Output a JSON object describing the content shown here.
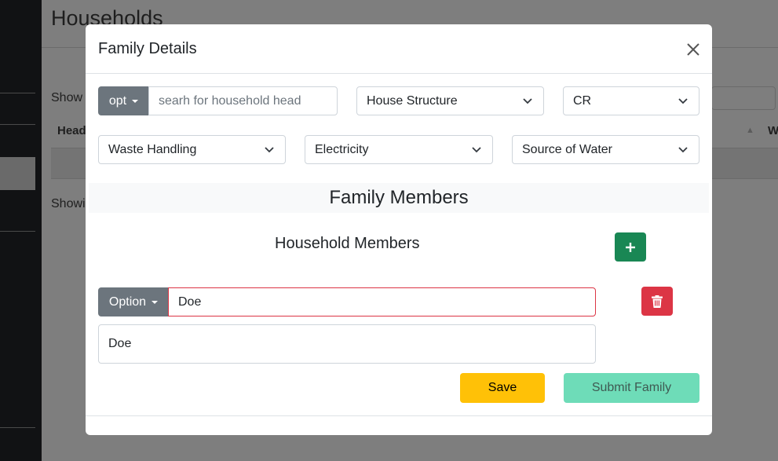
{
  "background": {
    "page_title": "Households",
    "show_label": "Show",
    "table_head": "Head",
    "table_head_right": "W",
    "showing_label": "Showi"
  },
  "modal": {
    "title": "Family Details",
    "close_icon": "close-icon",
    "search": {
      "option_label": "opt",
      "placeholder": "searh for household head"
    },
    "selects": {
      "house_structure": "House Structure",
      "cr": "CR",
      "waste_handling": "Waste Handling",
      "electricity": "Electricity",
      "source_of_water": "Source of Water"
    },
    "family_members_title": "Family Members",
    "household_members_label": "Household Members",
    "add_member_icon": "plus-icon",
    "member": {
      "option_label": "Option",
      "input_value": "Doe",
      "textarea_value": "Doe",
      "delete_icon": "trash-icon"
    },
    "save_label": "Save",
    "submit_label": "Submit Family"
  },
  "colors": {
    "success": "#198754",
    "danger": "#dc3545",
    "warning": "#ffc107",
    "secondary": "#6c757d",
    "submit_disabled": "#6edcb8",
    "invalid_border": "#dc3545"
  }
}
